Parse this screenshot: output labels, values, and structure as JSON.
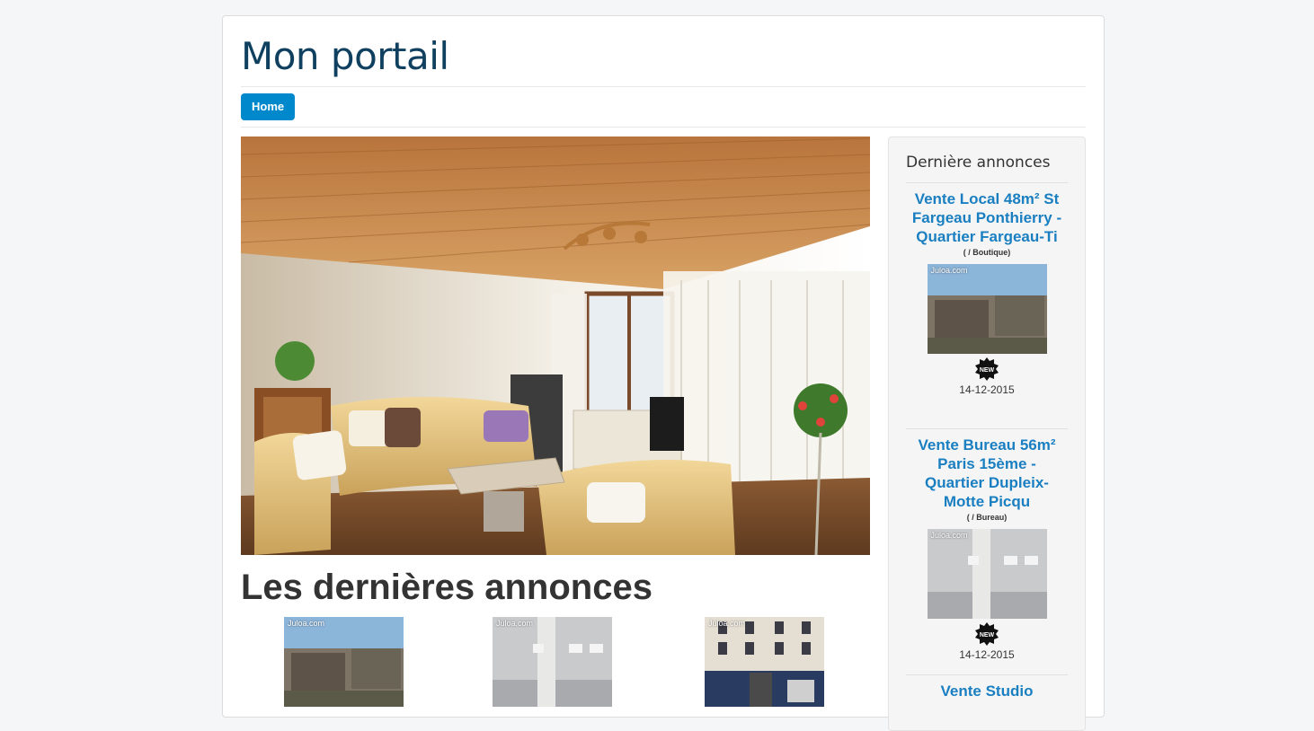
{
  "site": {
    "title": "Mon portail"
  },
  "nav": {
    "home_label": "Home"
  },
  "main": {
    "heading": "Les dernières annonces",
    "thumbnails": [
      {
        "watermark": "Juloa.com",
        "icon": "garage-photo"
      },
      {
        "watermark": "Juloa.com",
        "icon": "empty-office-photo"
      },
      {
        "watermark": "Juloa.com",
        "icon": "building-facade-photo"
      }
    ]
  },
  "sidebar": {
    "title": "Dernière annonces",
    "listings": [
      {
        "title": "Vente Local 48m² St Fargeau Ponthierry - Quartier Fargeau-Ti",
        "category": "( / Boutique)",
        "watermark": "Juloa.com",
        "badge": "NEW",
        "date": "14-12-2015"
      },
      {
        "title": "Vente Bureau 56m² Paris 15ème - Quartier Dupleix-Motte Picqu",
        "category": "( / Bureau)",
        "watermark": "Juloa.com",
        "badge": "NEW",
        "date": "14-12-2015"
      },
      {
        "title": "Vente Studio",
        "category": "",
        "watermark": "",
        "badge": "",
        "date": ""
      }
    ]
  },
  "colors": {
    "title": "#10405f",
    "accent": "#0088cc",
    "link": "#1a7fc1"
  }
}
